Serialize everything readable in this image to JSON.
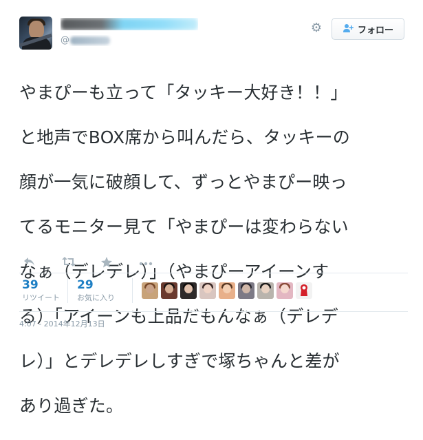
{
  "tweet": {
    "text_lines": [
      "やまぴーも立って「タッキー大好き！！」",
      "と地声でBOX席から叫んだら、タッキーの",
      "顔が一気に破顔して、ずっとやまぴー映っ",
      "てるモニター見て「やまぴーは変わらない",
      "なぁ（デレデレ）」（やまぴーアイーンす",
      "る）「アイーンも上品だもんなぁ（デレデ",
      "レ）」とデレデレしすぎで塚ちゃんと差が",
      "あり過ぎた。"
    ],
    "timestamp": "4:07 - 2014年12月13日"
  },
  "header": {
    "follow_label": "フォロー",
    "gear_icon": "gear-icon",
    "follow_icon": "add-user-icon"
  },
  "stats": {
    "retweets": {
      "count": "39",
      "label": "リツイート"
    },
    "favorites": {
      "count": "29",
      "label": "お気に入り"
    }
  },
  "actions": [
    {
      "name": "reply-icon",
      "glyph": "↰"
    },
    {
      "name": "retweet-icon",
      "glyph": "⇄"
    },
    {
      "name": "favorite-icon",
      "glyph": "★"
    },
    {
      "name": "more-icon",
      "glyph": "•••"
    }
  ],
  "favoriters": [
    {
      "bg": "#c8a37a"
    },
    {
      "bg": "#6b3a2e"
    },
    {
      "bg": "#2e2a2a"
    },
    {
      "bg": "#d9c6c0"
    },
    {
      "bg": "#e8b08a"
    },
    {
      "bg": "#7d7a86"
    },
    {
      "bg": "#b9b4ad"
    },
    {
      "bg": "#e3b7c2"
    },
    {
      "bg": "#f2f2f2"
    }
  ],
  "colors": {
    "link_blue": "#1e7fc4",
    "muted_gray": "#8899a6",
    "text": "#292f33"
  }
}
